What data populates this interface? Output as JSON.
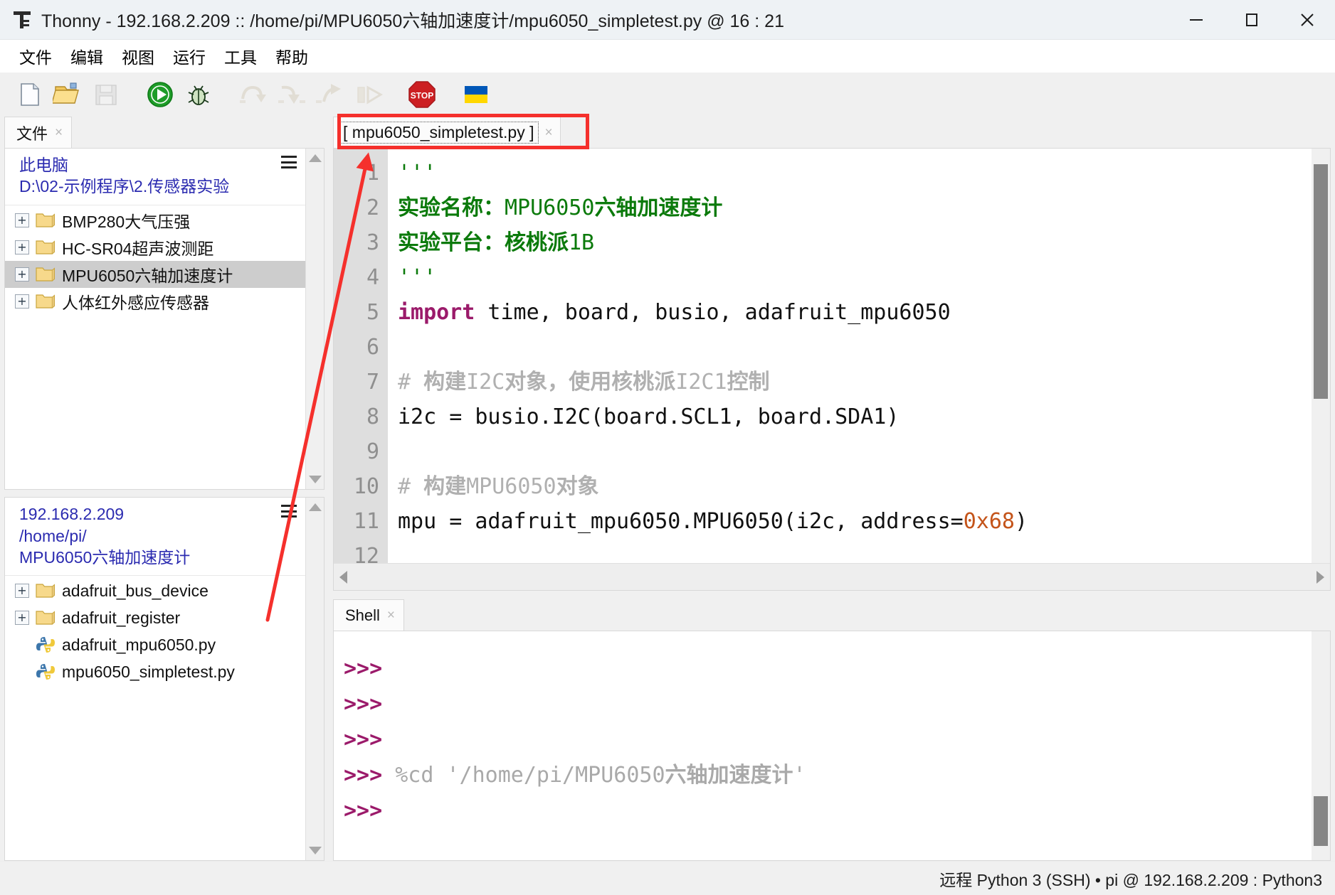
{
  "window": {
    "app_name": "Thonny",
    "title": "Thonny  -  192.168.2.209 :: /home/pi/MPU6050六轴加速度计/mpu6050_simpletest.py  @  16 : 21",
    "controls": {
      "minimize": "minimize-icon",
      "maximize": "maximize-icon",
      "close": "close-icon"
    }
  },
  "menubar": {
    "items": [
      {
        "label": "文件"
      },
      {
        "label": "编辑"
      },
      {
        "label": "视图"
      },
      {
        "label": "运行"
      },
      {
        "label": "工具"
      },
      {
        "label": "帮助"
      }
    ]
  },
  "toolbar": {
    "buttons": [
      {
        "name": "new-file-icon",
        "enabled": true
      },
      {
        "name": "open-file-icon",
        "enabled": true
      },
      {
        "name": "save-file-icon",
        "enabled": false
      },
      {
        "name": "run-icon",
        "enabled": true
      },
      {
        "name": "debug-icon",
        "enabled": true
      },
      {
        "name": "step-over-icon",
        "enabled": false
      },
      {
        "name": "step-into-icon",
        "enabled": false
      },
      {
        "name": "step-out-icon",
        "enabled": false
      },
      {
        "name": "resume-icon",
        "enabled": false
      },
      {
        "name": "stop-icon",
        "enabled": true
      },
      {
        "name": "ukraine-flag-icon",
        "enabled": true
      }
    ]
  },
  "files_panel": {
    "tab_label": "文件",
    "tab_close": "×",
    "local": {
      "header_lines": [
        "此电脑",
        "D:\\02-示例程序\\2.传感器实验"
      ],
      "menu_icon": "hamburger-icon",
      "rows": [
        {
          "expander": "+",
          "icon": "folder-icon",
          "label": "BMP280大气压强",
          "selected": false
        },
        {
          "expander": "+",
          "icon": "folder-icon",
          "label": "HC-SR04超声波测距",
          "selected": false
        },
        {
          "expander": "+",
          "icon": "folder-icon",
          "label": "MPU6050六轴加速度计",
          "selected": true
        },
        {
          "expander": "+",
          "icon": "folder-icon",
          "label": "人体红外感应传感器",
          "selected": false
        }
      ]
    },
    "remote": {
      "header_lines": [
        "192.168.2.209",
        "/home/pi/",
        "MPU6050六轴加速度计"
      ],
      "menu_icon": "hamburger-icon",
      "rows": [
        {
          "expander": "+",
          "icon": "folder-icon",
          "label": "adafruit_bus_device",
          "selected": false
        },
        {
          "expander": "+",
          "icon": "folder-icon",
          "label": "adafruit_register",
          "selected": false
        },
        {
          "expander": "",
          "icon": "python-file-icon",
          "label": "adafruit_mpu6050.py",
          "selected": false
        },
        {
          "expander": "",
          "icon": "python-file-icon",
          "label": "mpu6050_simpletest.py",
          "selected": false
        }
      ]
    }
  },
  "editor": {
    "tab_label": "[ mpu6050_simpletest.py ]",
    "tab_close": "×",
    "line_numbers": [
      "1",
      "2",
      "3",
      "4",
      "5",
      "6",
      "7",
      "8",
      "9",
      "10",
      "11",
      "12"
    ],
    "lines": [
      [
        {
          "t": "'''",
          "c": "k-doc-plain"
        }
      ],
      [
        {
          "t": "实验名称：",
          "c": "k-doc"
        },
        {
          "t": "MPU6050",
          "c": "k-doc-plain"
        },
        {
          "t": "六轴加速度计",
          "c": "k-doc"
        }
      ],
      [
        {
          "t": "实验平台：核桃派",
          "c": "k-doc"
        },
        {
          "t": "1B",
          "c": "k-doc-plain"
        }
      ],
      [
        {
          "t": "'''",
          "c": "k-doc-plain"
        }
      ],
      [
        {
          "t": "import",
          "c": "k-kw"
        },
        {
          "t": " time, board, busio, adafruit_mpu6050",
          "c": "k-txt"
        }
      ],
      [
        {
          "t": "",
          "c": "k-txt"
        }
      ],
      [
        {
          "t": "# ",
          "c": "k-cmt"
        },
        {
          "t": "构建",
          "c": "k-cmt-b"
        },
        {
          "t": "I2C",
          "c": "k-cmt"
        },
        {
          "t": "对象，使用核桃派",
          "c": "k-cmt-b"
        },
        {
          "t": "I2C1",
          "c": "k-cmt"
        },
        {
          "t": "控制",
          "c": "k-cmt-b"
        }
      ],
      [
        {
          "t": "i2c = busio.I2C(board.SCL1, board.SDA1)",
          "c": "k-txt"
        }
      ],
      [
        {
          "t": "",
          "c": "k-txt"
        }
      ],
      [
        {
          "t": "# ",
          "c": "k-cmt"
        },
        {
          "t": "构建",
          "c": "k-cmt-b"
        },
        {
          "t": "MPU6050",
          "c": "k-cmt"
        },
        {
          "t": "对象",
          "c": "k-cmt-b"
        }
      ],
      [
        {
          "t": "mpu = adafruit_mpu6050.MPU6050(i2c, address=",
          "c": "k-txt"
        },
        {
          "t": "0x68",
          "c": "k-num"
        },
        {
          "t": ")",
          "c": "k-txt"
        }
      ],
      [
        {
          "t": "",
          "c": "k-txt"
        }
      ]
    ]
  },
  "shell": {
    "tab_label": "Shell",
    "tab_close": "×",
    "lines": [
      [
        {
          "t": ">>>",
          "c": "sh-prompt"
        }
      ],
      [
        {
          "t": ">>>",
          "c": "sh-prompt"
        }
      ],
      [
        {
          "t": ">>>",
          "c": "sh-prompt"
        }
      ],
      [
        {
          "t": ">>>",
          "c": "sh-prompt"
        },
        {
          "t": " %cd '/home/pi/MPU6050",
          "c": "sh-cmd"
        },
        {
          "t": "六轴加速度计",
          "c": "sh-cmd-b"
        },
        {
          "t": "'",
          "c": "sh-cmd"
        }
      ],
      [
        {
          "t": ">>>",
          "c": "sh-prompt"
        }
      ]
    ]
  },
  "statusbar": {
    "text": "远程 Python 3 (SSH)  •  pi @ 192.168.2.209 : Python3"
  },
  "annotations": {
    "highlight_color": "#f5302c",
    "rect_target": "editor-tab",
    "arrow_from": "mpu6050_simpletest.py",
    "arrow_to": "editor-tab"
  },
  "colors": {
    "accent_red": "#f5302c",
    "docstring_green": "#0b7a0b",
    "keyword_magenta": "#9b1a6a",
    "comment_gray": "#b0b0b0",
    "number_orange": "#c4541a",
    "link_blue": "#2b2bb0"
  }
}
